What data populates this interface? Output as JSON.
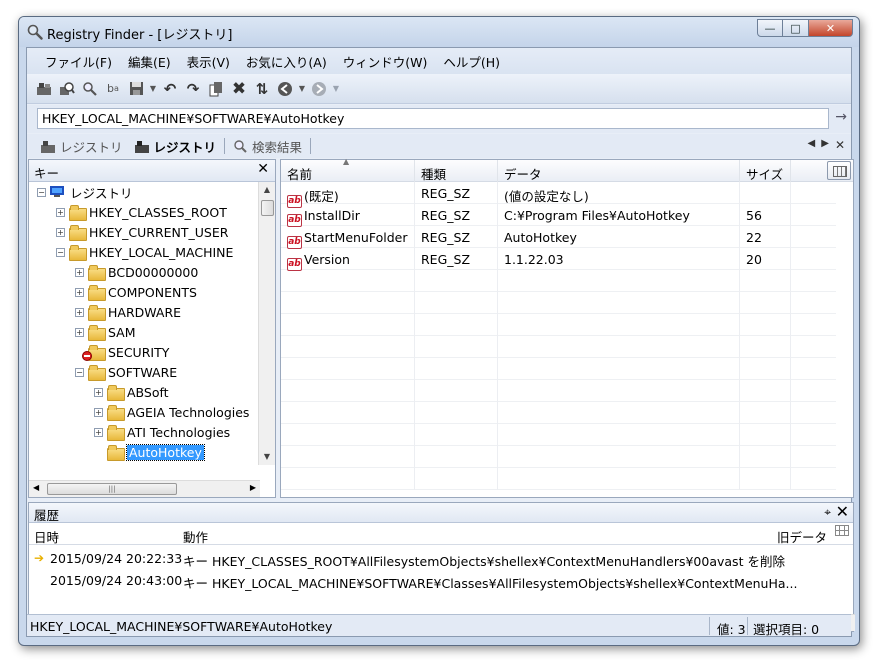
{
  "window": {
    "title": "Registry Finder - [レジストリ]"
  },
  "menu": [
    "ファイル(F)",
    "編集(E)",
    "表示(V)",
    "お気に入り(A)",
    "ウィンドウ(W)",
    "ヘルプ(H)"
  ],
  "toolbar": {
    "icons": [
      "connect-registry-icon",
      "search-registry-icon",
      "find-icon",
      "replace-icon",
      "save-icon",
      "undo-icon",
      "redo-icon",
      "copy-icon",
      "delete-icon",
      "refresh-icon",
      "back-icon",
      "forward-icon"
    ]
  },
  "address": {
    "value": "HKEY_LOCAL_MACHINE¥SOFTWARE¥AutoHotkey"
  },
  "tabs": [
    {
      "label": "レジストリ",
      "active": false
    },
    {
      "label": "レジストリ",
      "active": true
    },
    {
      "label": "検索結果",
      "active": false
    }
  ],
  "keypane": {
    "header": "キー",
    "tree": [
      {
        "label": "レジストリ",
        "level": 0,
        "icon": "computer-icon",
        "expander": "-"
      },
      {
        "label": "HKEY_CLASSES_ROOT",
        "level": 1,
        "expander": "+"
      },
      {
        "label": "HKEY_CURRENT_USER",
        "level": 1,
        "expander": "+"
      },
      {
        "label": "HKEY_LOCAL_MACHINE",
        "level": 1,
        "expander": "-"
      },
      {
        "label": "BCD00000000",
        "level": 2,
        "expander": "+"
      },
      {
        "label": "COMPONENTS",
        "level": 2,
        "expander": "+"
      },
      {
        "label": "HARDWARE",
        "level": 2,
        "expander": "+"
      },
      {
        "label": "SAM",
        "level": 2,
        "expander": "+"
      },
      {
        "label": "SECURITY",
        "level": 2,
        "expander": "",
        "denied": true
      },
      {
        "label": "SOFTWARE",
        "level": 2,
        "expander": "-"
      },
      {
        "label": "ABSoft",
        "level": 3,
        "expander": "+"
      },
      {
        "label": "AGEIA Technologies",
        "level": 3,
        "expander": "+"
      },
      {
        "label": "ATI Technologies",
        "level": 3,
        "expander": "+"
      },
      {
        "label": "AutoHotkey",
        "level": 3,
        "expander": "",
        "selected": true
      }
    ]
  },
  "valuepane": {
    "columns": [
      "名前",
      "種類",
      "データ",
      "サイズ"
    ],
    "rows": [
      {
        "name": "(既定)",
        "type": "REG_SZ",
        "data": "(値の設定なし)",
        "size": ""
      },
      {
        "name": "InstallDir",
        "type": "REG_SZ",
        "data": "C:¥Program Files¥AutoHotkey",
        "size": "56"
      },
      {
        "name": "StartMenuFolder",
        "type": "REG_SZ",
        "data": "AutoHotkey",
        "size": "22"
      },
      {
        "name": "Version",
        "type": "REG_SZ",
        "data": "1.1.22.03",
        "size": "20"
      }
    ]
  },
  "history": {
    "title": "履歴",
    "columns": [
      "日時",
      "動作",
      "旧データ"
    ],
    "rows": [
      {
        "time": "2015/09/24 20:22:33",
        "action": "キー HKEY_CLASSES_ROOT¥AllFilesystemObjects¥shellex¥ContextMenuHandlers¥00avast を削除",
        "current": true
      },
      {
        "time": "2015/09/24 20:43:00",
        "action": "キー HKEY_LOCAL_MACHINE¥SOFTWARE¥Classes¥AllFilesystemObjects¥shellex¥ContextMenuHa...",
        "current": false
      }
    ]
  },
  "status": {
    "path": "HKEY_LOCAL_MACHINE¥SOFTWARE¥AutoHotkey",
    "values": "値: 3",
    "selected": "選択項目: 0"
  }
}
